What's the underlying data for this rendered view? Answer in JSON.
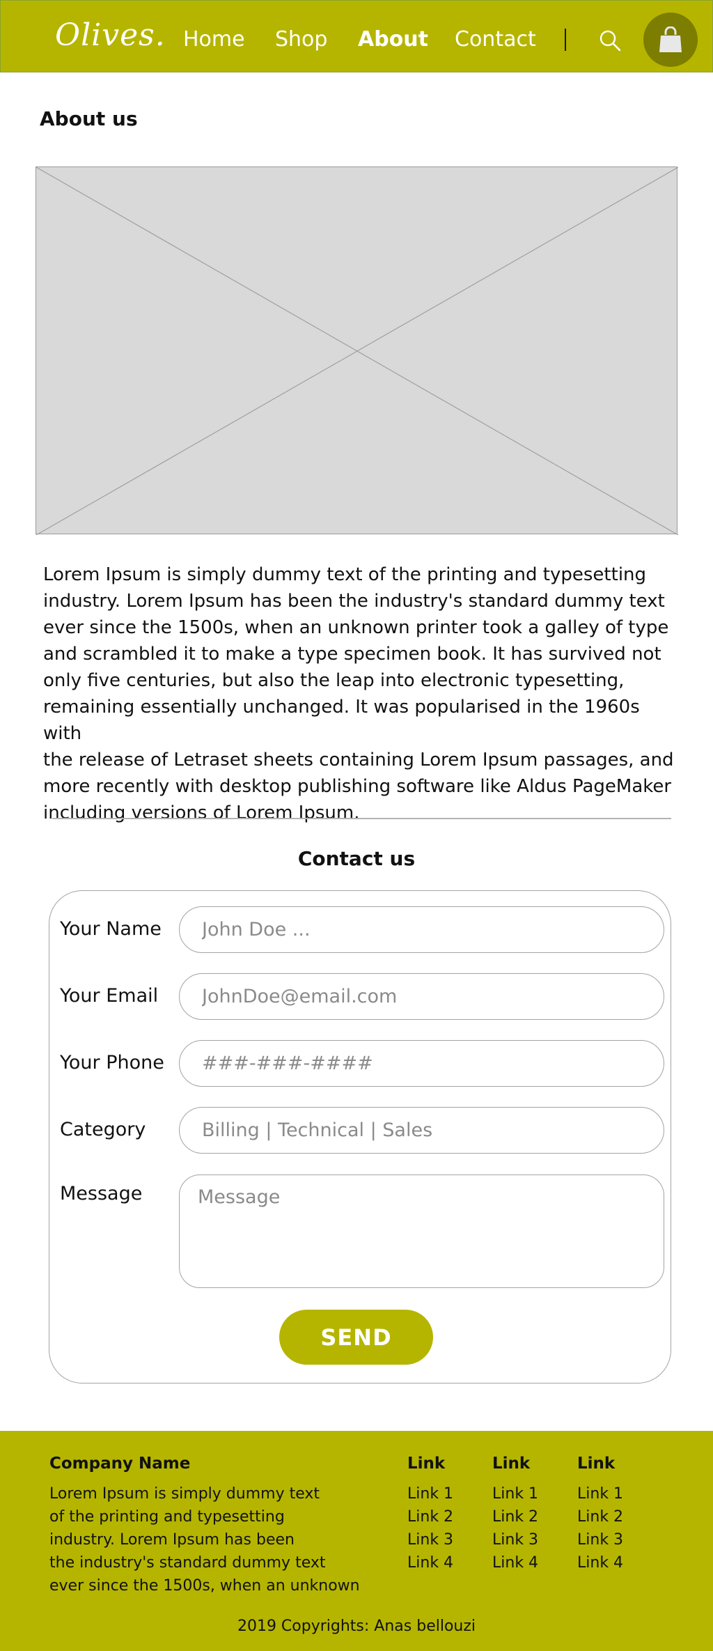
{
  "nav": {
    "logo": "Olives.",
    "links": [
      "Home",
      "Shop",
      "About",
      "Contact"
    ],
    "active": "About",
    "search_icon": "search-icon",
    "cart_icon": "shopping-bag-icon"
  },
  "about": {
    "title": "About us",
    "image": "image-placeholder",
    "text": "Lorem Ipsum is simply dummy text of the printing and typesetting\nindustry. Lorem Ipsum has been the industry's standard dummy text\never since the 1500s, when an unknown printer took a galley of type\nand scrambled it to make a type specimen book. It has survived not\nonly five centuries, but also the leap into electronic typesetting,\nremaining essentially unchanged. It was popularised in the 1960s with\nthe release of Letraset sheets containing Lorem Ipsum passages, and\n more recently with desktop publishing software like Aldus PageMaker\nincluding versions of Lorem Ipsum."
  },
  "contact": {
    "title": "Contact us",
    "fields": [
      {
        "label": "Your Name",
        "placeholder": "John Doe ..."
      },
      {
        "label": "Your Email",
        "placeholder": "JohnDoe@email.com"
      },
      {
        "label": "Your Phone",
        "placeholder": "###-###-####"
      },
      {
        "label": "Category",
        "placeholder": "Billing | Technical | Sales"
      }
    ],
    "message_label": "Message",
    "message_placeholder": "Message",
    "send_label": "SEND"
  },
  "footer": {
    "company_name": "Company Name",
    "company_desc": "Lorem Ipsum is simply dummy text\nof the printing and typesetting\nindustry. Lorem Ipsum has been\nthe industry's standard dummy text\never since the 1500s, when an unknown",
    "columns": [
      {
        "head": "Link",
        "links": [
          "Link 1",
          "Link 2",
          "Link 3",
          "Link 4"
        ]
      },
      {
        "head": "Link",
        "links": [
          "Link 1",
          "Link 2",
          "Link 3",
          "Link 4"
        ]
      },
      {
        "head": "Link",
        "links": [
          "Link 1",
          "Link 2",
          "Link 3",
          "Link 4"
        ]
      }
    ],
    "copyright": "2019 Copyrights: Anas bellouzi"
  },
  "colors": {
    "brand": "#b5b500",
    "brand_dark": "#7d7d00",
    "placeholder_bg": "#d9d9d9"
  }
}
